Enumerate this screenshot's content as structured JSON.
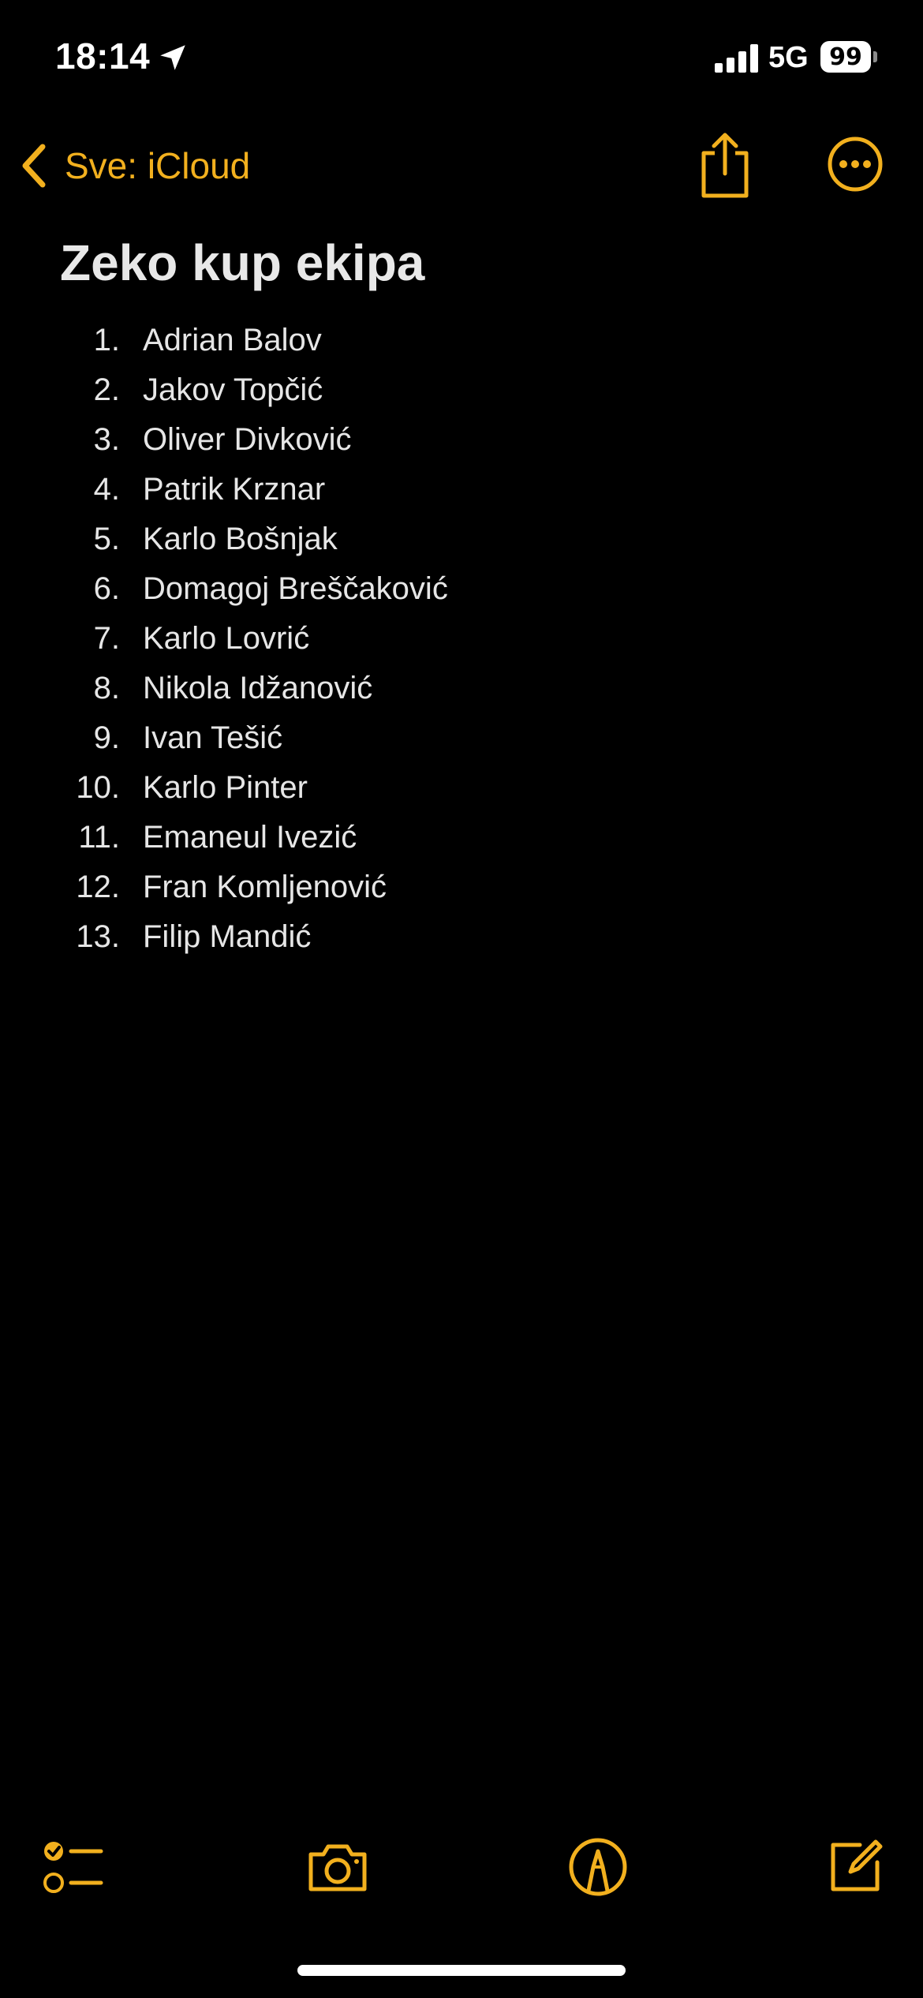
{
  "status_bar": {
    "time": "18:14",
    "network": "5G",
    "battery_level": "99",
    "icons": [
      "location-arrow-icon",
      "signal-bars-icon",
      "battery-icon"
    ]
  },
  "nav": {
    "back_label": "Sve: iCloud",
    "icons": [
      "chevron-left-icon",
      "share-icon",
      "ellipsis-circle-icon"
    ]
  },
  "note": {
    "title": "Zeko kup ekipa",
    "items": [
      {
        "num": "1.",
        "text": "Adrian Balov"
      },
      {
        "num": "2.",
        "text": "Jakov Topčić"
      },
      {
        "num": "3.",
        "text": "Oliver Divković"
      },
      {
        "num": "4.",
        "text": "Patrik Krznar"
      },
      {
        "num": "5.",
        "text": "Karlo Bošnjak"
      },
      {
        "num": "6.",
        "text": "Domagoj Breščaković"
      },
      {
        "num": "7.",
        "text": "Karlo Lovrić"
      },
      {
        "num": "8.",
        "text": "Nikola Idžanović"
      },
      {
        "num": "9.",
        "text": "Ivan Tešić"
      },
      {
        "num": "10.",
        "text": "Karlo Pinter"
      },
      {
        "num": "11.",
        "text": "Emaneul Ivezić"
      },
      {
        "num": "12.",
        "text": "Fran Komljenović"
      },
      {
        "num": "13.",
        "text": "Filip Mandić"
      }
    ]
  },
  "toolbar": {
    "icons": [
      "checklist-icon",
      "camera-icon",
      "markup-pen-icon",
      "compose-icon"
    ]
  },
  "colors": {
    "accent": "#f2b01e",
    "background": "#000000",
    "text": "#e6e6e6"
  }
}
